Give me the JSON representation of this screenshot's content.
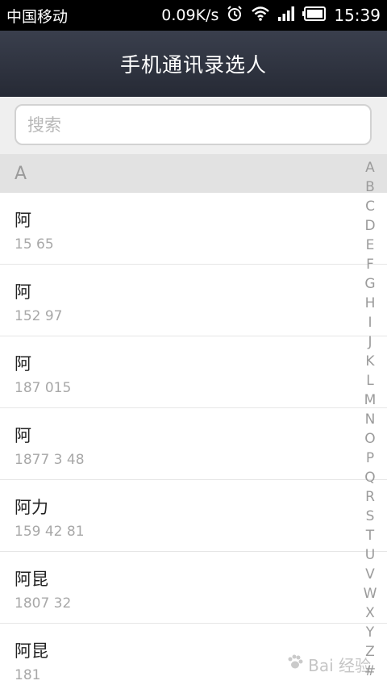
{
  "status_bar": {
    "carrier": "中国移动",
    "net_speed": "0.09K/s",
    "time": "15:39",
    "icons": [
      "alarm-icon",
      "wifi-icon",
      "signal-icon",
      "battery-icon"
    ]
  },
  "header": {
    "title": "手机通讯录选人"
  },
  "search": {
    "placeholder": "搜索"
  },
  "section": {
    "letter": "A"
  },
  "contacts": [
    {
      "name": "阿",
      "phone": "15   65"
    },
    {
      "name": "阿",
      "phone": "152   97"
    },
    {
      "name": "阿",
      "phone": "187   015"
    },
    {
      "name": "阿",
      "phone": "1877 3 48"
    },
    {
      "name": "阿力",
      "phone": "159 42 81"
    },
    {
      "name": "阿昆",
      "phone": "1807   32"
    },
    {
      "name": "阿昆",
      "phone": "181"
    }
  ],
  "index_letters": [
    "A",
    "B",
    "C",
    "D",
    "E",
    "F",
    "G",
    "H",
    "I",
    "J",
    "K",
    "L",
    "M",
    "N",
    "O",
    "P",
    "Q",
    "R",
    "S",
    "T",
    "U",
    "V",
    "W",
    "X",
    "Y",
    "Z",
    "#"
  ],
  "watermark": {
    "text": "Bai 经验"
  },
  "colors": {
    "header_top": "#3a3f4d",
    "header_bottom": "#262a35",
    "status_bg": "#000000"
  }
}
